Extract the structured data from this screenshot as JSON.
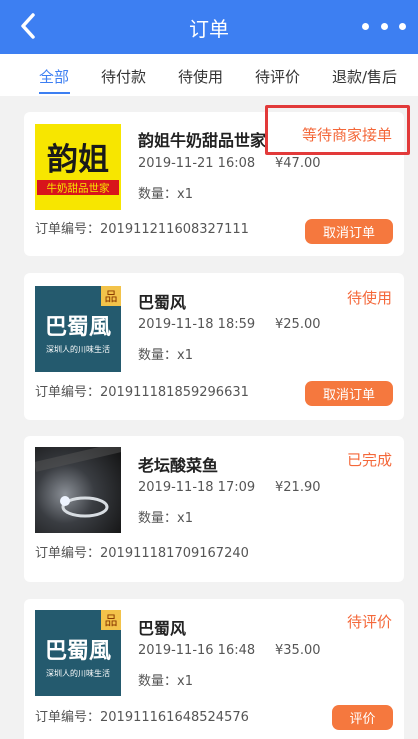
{
  "header": {
    "title": "订单",
    "back_icon": "chevron-left-icon",
    "more_icon": "more-dots-icon"
  },
  "tabs": [
    {
      "label": "全部",
      "active": true
    },
    {
      "label": "待付款",
      "active": false
    },
    {
      "label": "待使用",
      "active": false
    },
    {
      "label": "待评价",
      "active": false
    },
    {
      "label": "退款/售后",
      "active": false
    }
  ],
  "orders": [
    {
      "shop": "韵姐牛奶甜品世家",
      "status": "等待商家接单",
      "date": "2019-11-21 16:08",
      "price": "¥47.00",
      "qty": "数量：x1",
      "order_no": "订单编号：201911211608327111",
      "action": "取消订单",
      "logo_main": "韵姐",
      "logo_sub": "牛奶甜品世家"
    },
    {
      "shop": "巴蜀风",
      "status": "待使用",
      "date": "2019-11-18 18:59",
      "price": "¥25.00",
      "qty": "数量：x1",
      "order_no": "订单编号：201911181859296631",
      "action": "取消订单",
      "logo_badge": "品",
      "logo_main": "巴蜀風",
      "logo_sub": "深圳人的川味生活"
    },
    {
      "shop": "老坛酸菜鱼",
      "status": "已完成",
      "date": "2019-11-18 17:09",
      "price": "¥21.90",
      "qty": "数量：x1",
      "order_no": "订单编号：201911181709167240"
    },
    {
      "shop": "巴蜀风",
      "status": "待评价",
      "date": "2019-11-16 16:48",
      "price": "¥35.00",
      "qty": "数量：x1",
      "order_no": "订单编号：201911161648524576",
      "action": "评价",
      "logo_badge": "品",
      "logo_main": "巴蜀風",
      "logo_sub": "深圳人的川味生活"
    }
  ],
  "colors": {
    "primary": "#3d7ff2",
    "accent": "#f5783e",
    "status": "#f4683a",
    "highlight": "#e23a3a"
  }
}
